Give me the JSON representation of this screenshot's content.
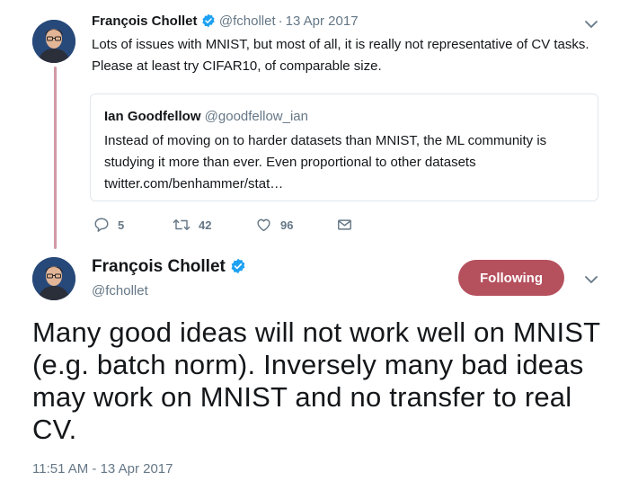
{
  "colors": {
    "text": "#14171a",
    "muted": "#657786",
    "border": "#e1e8ed",
    "accent": "#b5505d",
    "thread_line": "#d29aa6",
    "verified": "#1da1f2"
  },
  "reply_tweet": {
    "author_name": "François Chollet",
    "verified_icon": "verified-badge-icon",
    "handle": "@fchollet",
    "separator": "·",
    "date": "13 Apr 2017",
    "text": "Lots of issues with MNIST, but most of all, it is really not representative of CV tasks. Please at least try CIFAR10, of comparable size.",
    "menu_icon": "chevron-down-icon",
    "quoted_tweet": {
      "author_name": "Ian Goodfellow",
      "handle": "@goodfellow_ian",
      "text": "Instead of moving on to harder datasets than MNIST, the ML community is studying it more than ever. Even proportional to other datasets twitter.com/benhammer/stat…"
    },
    "actions": {
      "reply": {
        "icon": "reply-icon",
        "count": "5"
      },
      "retweet": {
        "icon": "retweet-icon",
        "count": "42"
      },
      "like": {
        "icon": "heart-icon",
        "count": "96"
      },
      "message": {
        "icon": "envelope-icon"
      }
    }
  },
  "main_tweet": {
    "author_name": "François Chollet",
    "verified_icon": "verified-badge-icon",
    "handle": "@fchollet",
    "follow_button": "Following",
    "menu_icon": "chevron-down-icon",
    "text": "Many good ideas will not work well on MNIST (e.g. batch norm). Inversely many bad ideas may work on MNIST and no transfer to real CV.",
    "timestamp": "11:51 AM - 13 Apr 2017"
  }
}
